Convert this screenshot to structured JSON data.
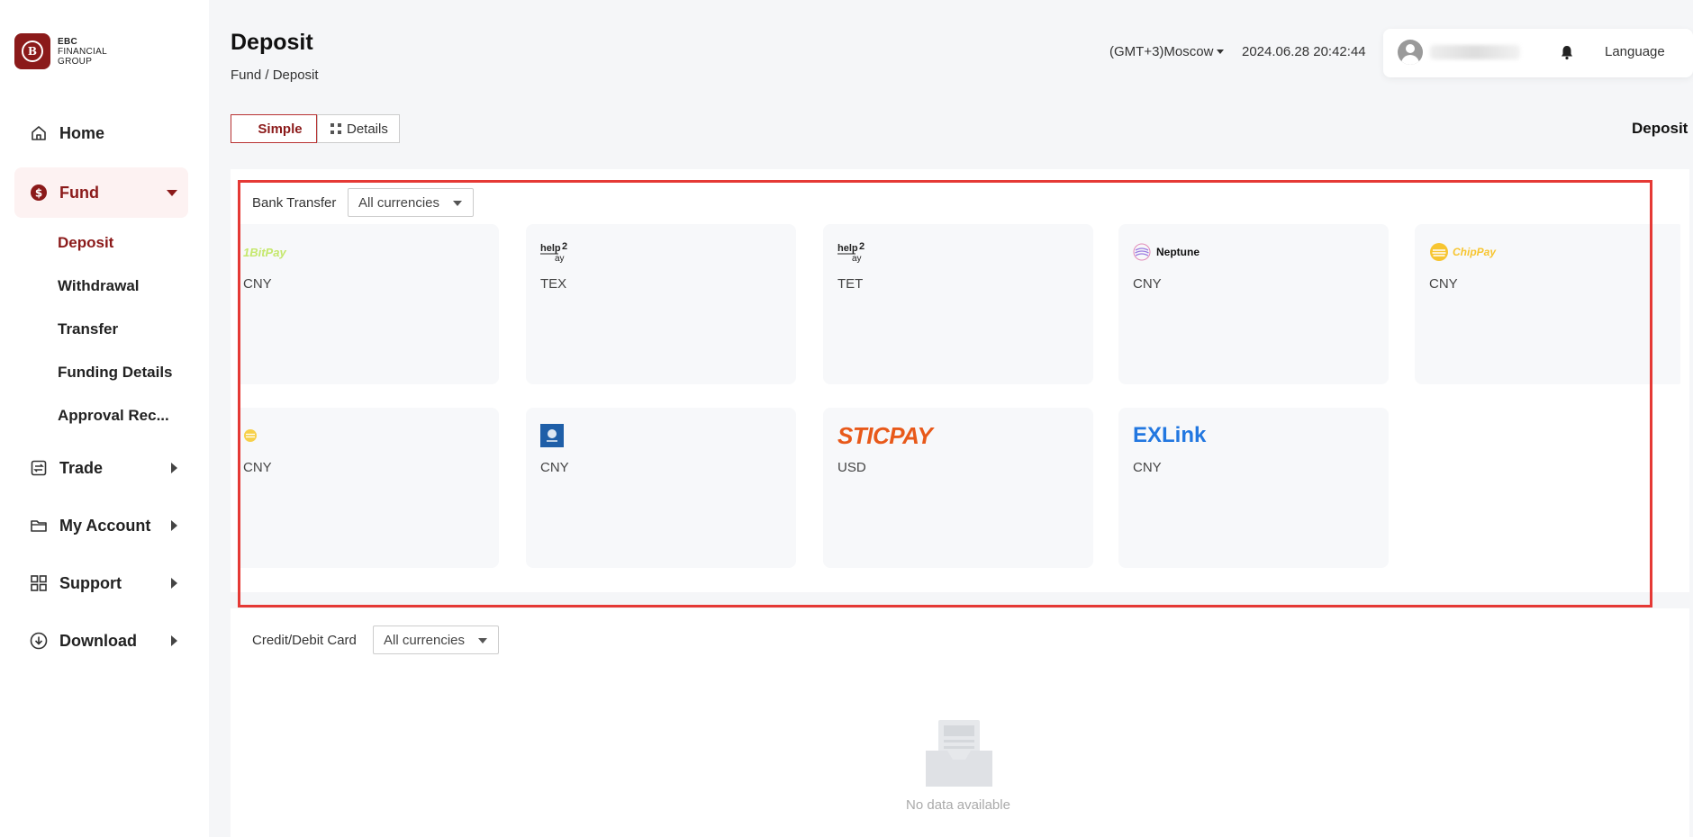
{
  "brand": {
    "line1": "EBC",
    "line2": "FINANCIAL",
    "line3": "GROUP"
  },
  "sidebar": {
    "items": [
      {
        "label": "Home"
      },
      {
        "label": "Fund"
      },
      {
        "label": "Trade"
      },
      {
        "label": "My Account"
      },
      {
        "label": "Support"
      },
      {
        "label": "Download"
      }
    ],
    "fund_sub": [
      "Deposit",
      "Withdrawal",
      "Transfer",
      "Funding Details",
      "Approval Rec..."
    ]
  },
  "header": {
    "title": "Deposit",
    "breadcrumb": "Fund / Deposit",
    "timezone": "(GMT+3)Moscow",
    "datetime": "2024.06.28 20:42:44",
    "language": "Language"
  },
  "tabs": {
    "simple": "Simple",
    "details": "Details"
  },
  "right_title": "Deposit",
  "bank_transfer": {
    "label": "Bank Transfer",
    "filter": "All currencies",
    "methods": [
      {
        "brand": "1BitPay",
        "currency": "CNY"
      },
      {
        "brand": "help2pay",
        "currency": "TEX"
      },
      {
        "brand": "help2pay",
        "currency": "TET"
      },
      {
        "brand": "Neptune",
        "currency": "CNY"
      },
      {
        "brand": "ChipPay",
        "currency": "CNY"
      },
      {
        "brand": "",
        "currency": "CNY"
      },
      {
        "brand": "",
        "currency": "CNY"
      },
      {
        "brand": "STICPAY",
        "currency": "USD"
      },
      {
        "brand": "EXLink",
        "currency": "CNY"
      }
    ]
  },
  "card_section": {
    "label": "Credit/Debit Card",
    "filter": "All currencies",
    "empty": "No data available"
  },
  "colors": {
    "accent": "#8b1a1a",
    "highlight": "#e53935"
  }
}
